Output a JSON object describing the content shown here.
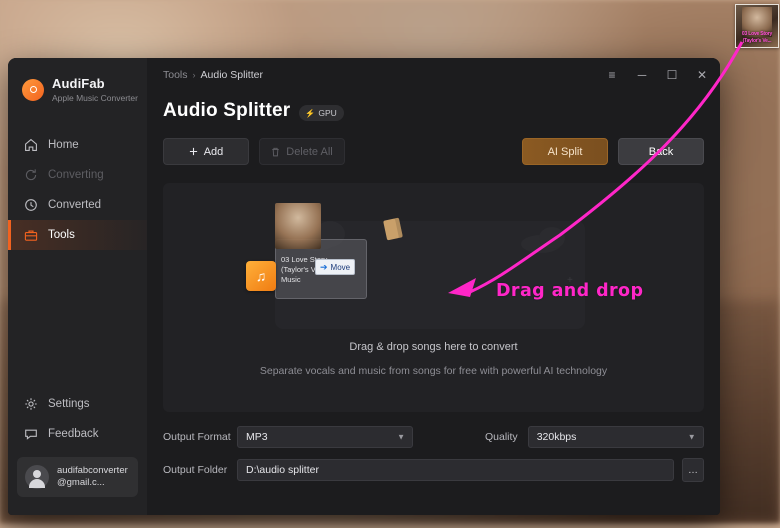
{
  "desktop": {
    "thumbnail": {
      "name": "desktop-file-thumbnail",
      "line1": "03 Love Story",
      "line2": "(Taylor's Ve..."
    }
  },
  "window": {
    "breadcrumb": {
      "root": "Tools",
      "separator": "›",
      "current": "Audio Splitter"
    },
    "controls": {
      "menu": "≡",
      "minimize": "─",
      "maximize": "☐",
      "close": "✕"
    }
  },
  "sidebar": {
    "brand": {
      "title": "AudiFab",
      "subtitle": "Apple Music Converter",
      "logo_icon": "audifab-logo-icon"
    },
    "items": [
      {
        "label": "Home",
        "icon": "home-icon",
        "state": "normal"
      },
      {
        "label": "Converting",
        "icon": "refresh-icon",
        "state": "disabled"
      },
      {
        "label": "Converted",
        "icon": "clock-icon",
        "state": "normal"
      },
      {
        "label": "Tools",
        "icon": "toolbox-icon",
        "state": "active"
      }
    ],
    "bottom_items": [
      {
        "label": "Settings",
        "icon": "gear-icon"
      },
      {
        "label": "Feedback",
        "icon": "chat-icon"
      }
    ],
    "account": {
      "email": "audifabconverter@gmail.c...",
      "avatar_icon": "user-avatar-icon"
    }
  },
  "page": {
    "title": "Audio Splitter",
    "gpu_badge": {
      "label": "GPU",
      "icon": "lightning-bolt-icon"
    }
  },
  "toolbar": {
    "add_label": "Add",
    "add_icon": "plus-icon",
    "delete_label": "Delete All",
    "delete_icon": "trash-icon",
    "ai_label": "AI Split",
    "back_label": "Back"
  },
  "dropzone": {
    "primary_text": "Drag & drop songs here to convert",
    "secondary_text": "Separate vocals and music from songs for free with powerful AI technology",
    "drag_preview": {
      "track_line1": "03 Love Story",
      "track_line2": "(Taylor's Ve...",
      "track_line3": "Music",
      "move_chip_label": "Move",
      "move_chip_icon": "move-arrow-icon",
      "file_icon": "music-file-icon"
    }
  },
  "form": {
    "output_format": {
      "label": "Output Format",
      "value": "MP3"
    },
    "quality": {
      "label": "Quality",
      "value": "320kbps"
    },
    "output_folder": {
      "label": "Output Folder",
      "value": "D:\\audio splitter",
      "browse_label": "…"
    }
  },
  "annotation": {
    "text": "Drag and drop",
    "color": "#ff26c8"
  }
}
